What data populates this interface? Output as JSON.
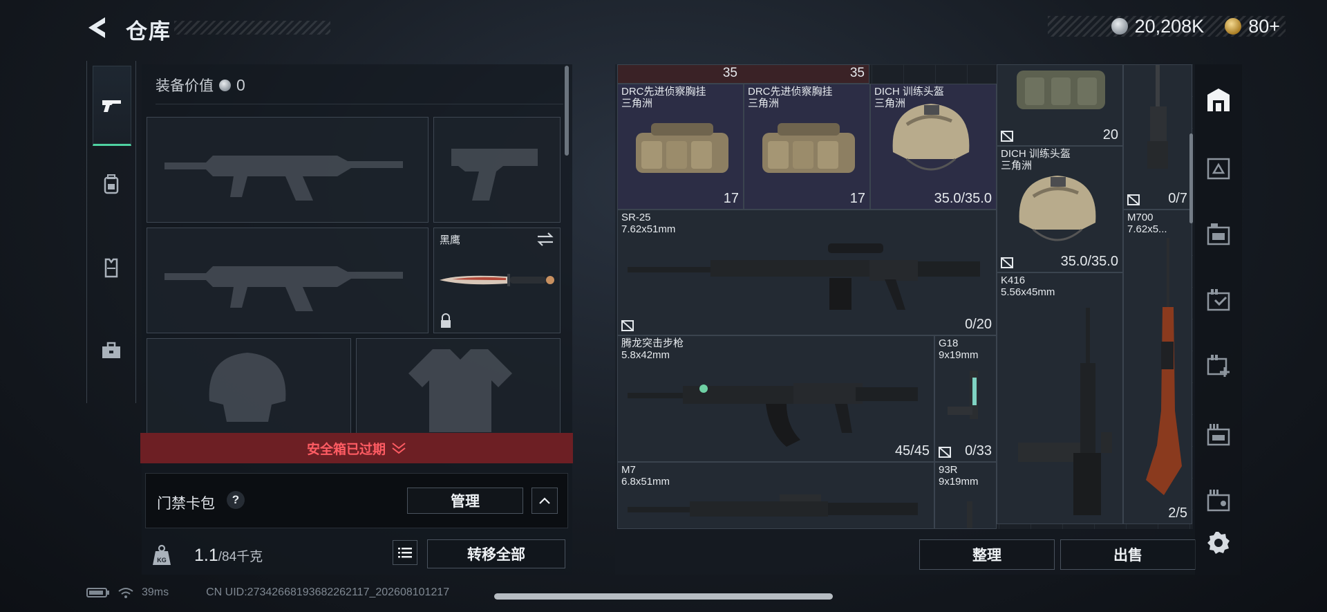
{
  "header": {
    "title": "仓库",
    "currency_silver": "20,208K",
    "currency_gold": "80+"
  },
  "sidebar": {
    "tabs": [
      {
        "name": "weapons",
        "icon": "pistol-icon",
        "active": true
      },
      {
        "name": "gear",
        "icon": "backpack-icon",
        "active": false
      },
      {
        "name": "vest",
        "icon": "vest-icon",
        "active": false
      },
      {
        "name": "case",
        "icon": "toolbox-icon",
        "active": false
      }
    ]
  },
  "equipment": {
    "value_label": "装备价值",
    "value": "0",
    "melee_name": "黑鹰",
    "warning": "安全箱已过期",
    "card_label": "门禁卡包",
    "help": "?",
    "manage_button": "管理",
    "weight_current": "1.1",
    "weight_max": "/84千克",
    "transfer_all_button": "转移全部"
  },
  "inventory": {
    "top_row": [
      {
        "value": "35"
      },
      {
        "value": "35"
      }
    ],
    "items": [
      {
        "name": "DRC先进侦察胸挂\n三角洲",
        "value": "17",
        "icon": "armor-icon"
      },
      {
        "name": "DRC先进侦察胸挂\n三角洲",
        "value": "17",
        "icon": "armor-icon"
      },
      {
        "name": "DICH 训练头盔\n三角洲",
        "value": "35.0/35.0"
      },
      {
        "name": "",
        "value": "20",
        "icon": "armor-icon"
      },
      {
        "name": "",
        "value": "0/7"
      },
      {
        "name": "DICH 训练头盔\n三角洲",
        "value": "35.0/35.0"
      },
      {
        "name": "SR-25\n7.62x51mm",
        "value": "0/20"
      },
      {
        "name": "M700\n7.62x5...",
        "value": "2/5"
      },
      {
        "name": "K416\n5.56x45mm",
        "value": ""
      },
      {
        "name": "腾龙突击步枪\n5.8x42mm",
        "value": "45/45"
      },
      {
        "name": "G18\n9x19mm",
        "value": "0/33"
      },
      {
        "name": "M7\n6.8x51mm",
        "value": ""
      },
      {
        "name": "93R\n9x19mm",
        "value": ""
      }
    ],
    "sort_button": "整理",
    "sell_button": "出售"
  },
  "right_bar": {
    "icons": [
      "safehouse-icon",
      "storage-1-icon",
      "storage-2-icon",
      "storage-3-icon",
      "storage-add-icon",
      "storage-4-icon",
      "storage-5-icon",
      "settings-icon"
    ]
  },
  "footer": {
    "ping": "39ms",
    "uid": "CN UID:2734266819368226211​7_202608101217"
  }
}
